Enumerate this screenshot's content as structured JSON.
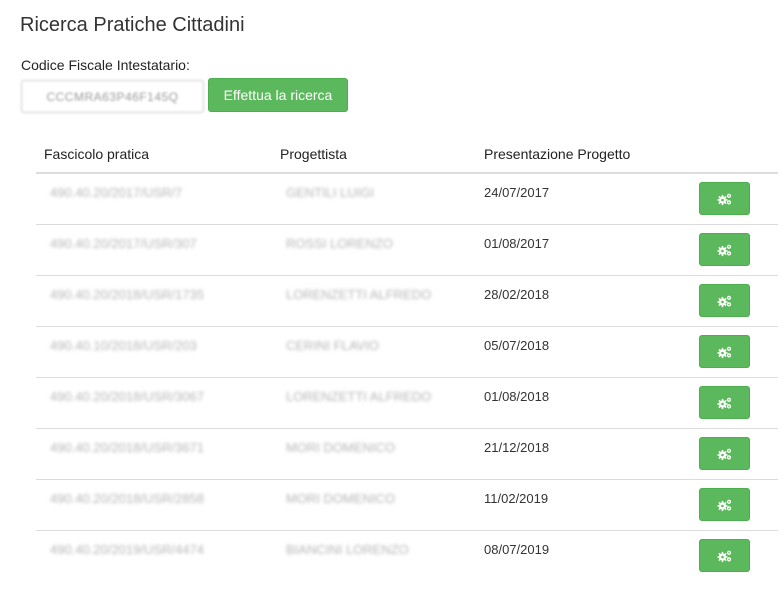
{
  "page": {
    "title": "Ricerca Pratiche Cittadini",
    "codice_fiscale_label": "Codice Fiscale Intestatario:",
    "codice_fiscale_value": "CCCMRA63P46F145Q",
    "search_button_label": "Effettua la ricerca"
  },
  "colors": {
    "accent": "#5cb85c"
  },
  "table": {
    "headers": [
      "Fascicolo pratica",
      "Progettista",
      "Presentazione Progetto"
    ],
    "action_icon": "gears-icon",
    "rows": [
      {
        "fascicolo": "490.40.20/2017/USR/7",
        "progettista": "GENTILI LUIGI",
        "data": "24/07/2017"
      },
      {
        "fascicolo": "490.40.20/2017/USR/307",
        "progettista": "ROSSI LORENZO",
        "data": "01/08/2017"
      },
      {
        "fascicolo": "490.40.20/2018/USR/1735",
        "progettista": "LORENZETTI ALFREDO",
        "data": "28/02/2018"
      },
      {
        "fascicolo": "490.40.10/2018/USR/203",
        "progettista": "CERINI FLAVIO",
        "data": "05/07/2018"
      },
      {
        "fascicolo": "490.40.20/2018/USR/3067",
        "progettista": "LORENZETTI ALFREDO",
        "data": "01/08/2018"
      },
      {
        "fascicolo": "490.40.20/2018/USR/3671",
        "progettista": "MORI DOMENICO",
        "data": "21/12/2018"
      },
      {
        "fascicolo": "490.40.20/2018/USR/2858",
        "progettista": "MORI DOMENICO",
        "data": "11/02/2019"
      },
      {
        "fascicolo": "490.40.20/2019/USR/4474",
        "progettista": "BIANCINI LORENZO",
        "data": "08/07/2019"
      }
    ]
  }
}
